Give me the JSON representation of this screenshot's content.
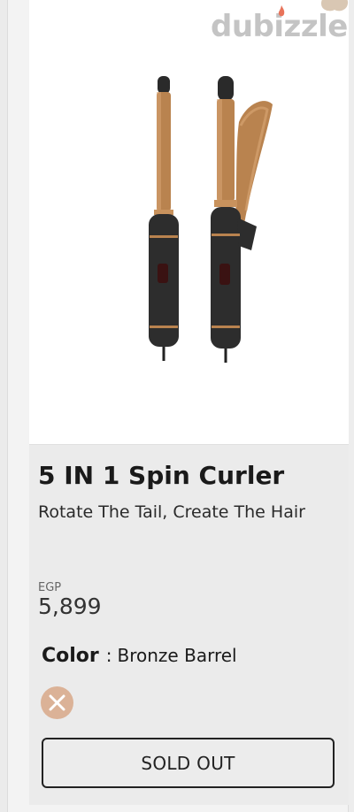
{
  "watermark": {
    "logo_text": "dubizzle"
  },
  "product": {
    "title": "5 IN 1 Spin Curler",
    "subtitle": "Rotate The Tail, Create The Hair",
    "currency": "EGP",
    "price": "5,899",
    "color_label": "Color",
    "color_separator": ":",
    "color_value": "Bronze Barrel",
    "selected_swatch_state": "unavailable-icon"
  },
  "actions": {
    "sold_out_label": "SOLD OUT"
  },
  "colors": {
    "swatch_bronze": "#dbb297",
    "barrel_bronze": "#b9834f",
    "handle_dark": "#2d2d2d"
  }
}
